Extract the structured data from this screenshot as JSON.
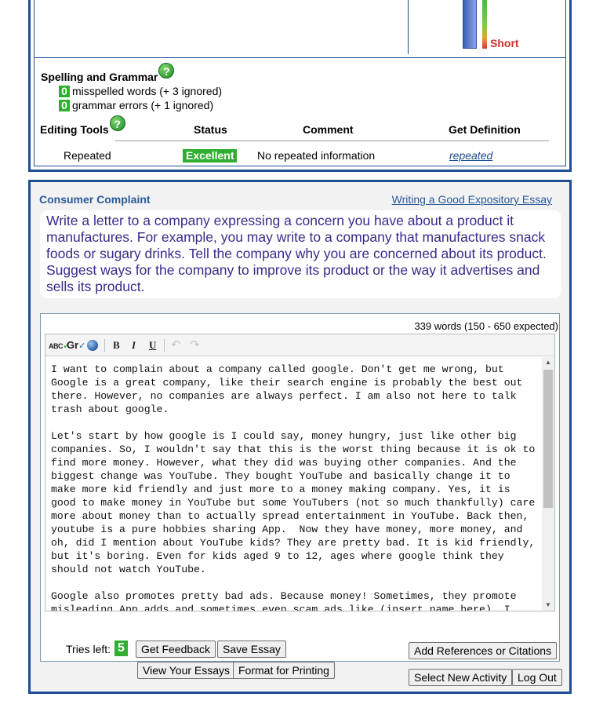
{
  "length_meter": {
    "label": "Short",
    "level": "short"
  },
  "spelling_grammar": {
    "title": "Spelling and Grammar",
    "misspelled_count": "0",
    "misspelled_text": "misspelled words (+ 3 ignored)",
    "grammar_count": "0",
    "grammar_text": "grammar errors (+ 1 ignored)"
  },
  "editing_tools": {
    "headers": {
      "tools": "Editing Tools",
      "status": "Status",
      "comment": "Comment",
      "definition": "Get Definition"
    },
    "rows": [
      {
        "tool": "Repeated",
        "status": "Excellent",
        "comment": "No repeated information",
        "definition": "repeated"
      }
    ]
  },
  "activity": {
    "title": "Consumer Complaint",
    "link": "Writing a Good Expository Essay",
    "prompt": "Write a letter to a company expressing a concern you have about a product it manufactures. For example, you may write to a company that manufactures snack foods or sugary drinks. Tell the company why you are concerned about its product. Suggest ways for the company to improve its product or the way it advertises and sells its product."
  },
  "editor": {
    "word_count": "339 words (150 - 650 expected)",
    "toolbar": {
      "spell": "ABC",
      "grammar": "Gr",
      "bold": "B",
      "italic": "I",
      "underline": "U",
      "undo": "↶",
      "redo": "↷"
    },
    "text": "I want to complain about a company called google. Don't get me wrong, but Google is a great company, like their search engine is probably the best out there. However, no companies are always perfect. I am also not here to talk trash about google.\n\nLet's start by how google is I could say, money hungry, just like other big companies. So, I wouldn't say that this is the worst thing because it is ok to find more money. However, what they did was buying other companies. And the biggest change was YouTube. They bought YouTube and basically change it to make more kid friendly and just more to a money making company. Yes, it is good to make money in YouTube but some YouTubers (not so much thankfully) care more about money than to actually spread entertainment in YouTube. Back then, youtube is a pure hobbies sharing App.  Now they have money, more money, and oh, did I mention about YouTube kids? They are pretty bad. It is kid friendly, but it's boring. Even for kids aged 9 to 12, ages where google think they should not watch YouTube.\n\nGoogle also promotes pretty bad ads. Because money! Sometimes, they promote misleading App adds and sometimes even scam ads like (insert name here). I feel"
  },
  "controls": {
    "tries_label": "Tries left:",
    "tries_count": "5",
    "get_feedback": "Get Feedback",
    "save_essay": "Save Essay",
    "add_references": "Add References or Citations",
    "view_essays": "View Your Essays",
    "format_printing": "Format for Printing",
    "select_new_activity": "Select New Activity",
    "log_out": "Log Out"
  },
  "colors": {
    "frame_blue": "#1e4f94",
    "status_green": "#2fae2f",
    "prompt_purple": "#3b2a8c",
    "short_red": "#c8332b"
  }
}
